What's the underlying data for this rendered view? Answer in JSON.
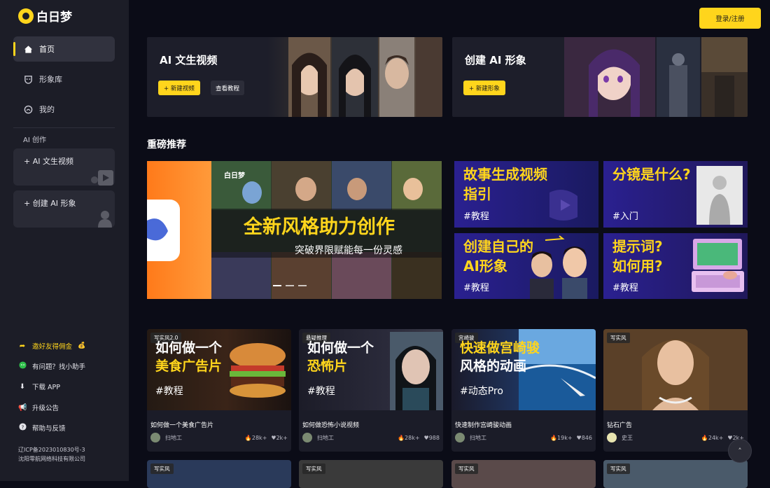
{
  "app": {
    "logo_text": "白日梦",
    "brand_color": "#ffd51c"
  },
  "sidebar": {
    "nav": [
      {
        "label": "首页",
        "icon": "home-icon"
      },
      {
        "label": "形象库",
        "icon": "mask-icon"
      },
      {
        "label": "我的",
        "icon": "user-face-icon"
      }
    ],
    "section_label": "AI 创作",
    "create": [
      {
        "label": "AI 文生视频"
      },
      {
        "label": "创建 AI 形象"
      }
    ],
    "footer": [
      {
        "label": "邀好友得佣金",
        "icon": "share-icon"
      },
      {
        "label": "有问题？找小助手",
        "icon": "wechat-icon"
      },
      {
        "label": "下载 APP",
        "icon": "download-icon"
      },
      {
        "label": "升级公告",
        "icon": "megaphone-icon"
      },
      {
        "label": "帮助与反馈",
        "icon": "help-icon"
      }
    ],
    "icp_line1": "辽ICP备2023010830号-3",
    "icp_line2": "沈阳零航网络科技有限公司"
  },
  "header": {
    "login_label": "登录/注册"
  },
  "banners": [
    {
      "title": "AI 文生视频",
      "primary": "+ 新建视频",
      "secondary": "查看教程"
    },
    {
      "title": "创建 AI 形象",
      "primary": "+ 新建形象"
    }
  ],
  "featured": {
    "heading": "重磅推荐",
    "hero": {
      "logo_text": "白日梦",
      "title": "全新风格助力创作",
      "subtitle": "突破界限赋能每一份灵感"
    },
    "tiles": [
      {
        "title1": "故事生成视频",
        "title2": "指引",
        "tag": "#教程"
      },
      {
        "title1": "分镜是什么?",
        "tag": "#入门"
      },
      {
        "title1": "创建自己的",
        "title2": "AI形象",
        "tag": "#教程"
      },
      {
        "title1": "提示词?",
        "title2": "如何用?",
        "tag": "#教程"
      }
    ]
  },
  "cards": [
    {
      "badge": "写实风2.0",
      "thumb1": "如何做一个",
      "thumb2": "美食广告片",
      "tag": "#教程",
      "title": "如何做一个美食广告片",
      "author": "扫地工",
      "hot": "28k+",
      "likes": "2k+"
    },
    {
      "badge": "悬疑推理",
      "thumb1": "如何做一个",
      "thumb2": "恐怖片",
      "tag": "#教程",
      "title": "如何做恐怖小说视频",
      "author": "扫地工",
      "hot": "28k+",
      "likes": "988"
    },
    {
      "badge": "宫崎骏",
      "thumb1": "快速做宫崎骏",
      "thumb2": "风格的动画",
      "tag": "#动态Pro",
      "title": "快速制作宫崎骏动画",
      "author": "扫地工",
      "hot": "19k+",
      "likes": "846"
    },
    {
      "badge": "写实风",
      "title": "钻石广告",
      "author": "史王",
      "hot": "24k+",
      "likes": "2k+"
    }
  ],
  "row2_badges": [
    "写实风",
    "写实风",
    "写实风",
    "写实风"
  ]
}
